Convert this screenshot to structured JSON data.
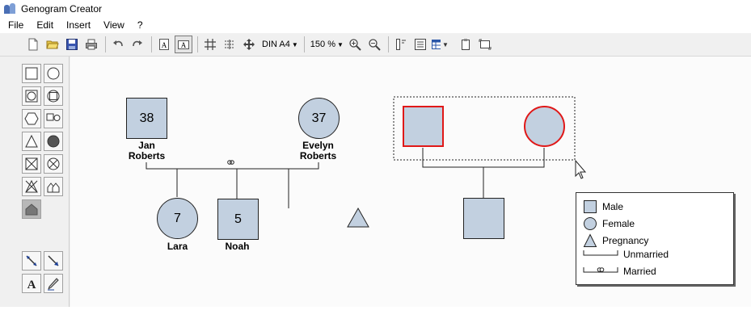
{
  "window": {
    "title": "Genogram Creator"
  },
  "menu": {
    "items": [
      "File",
      "Edit",
      "Insert",
      "View",
      "?"
    ]
  },
  "toolbar": {
    "page_size": "DIN A4",
    "zoom": "150 %"
  },
  "people": {
    "jan": {
      "age": "38",
      "first": "Jan",
      "last": "Roberts"
    },
    "evelyn": {
      "age": "37",
      "first": "Evelyn",
      "last": "Roberts"
    },
    "lara": {
      "age": "7",
      "name": "Lara"
    },
    "noah": {
      "age": "5",
      "name": "Noah"
    }
  },
  "legend": {
    "male": "Male",
    "female": "Female",
    "pregnancy": "Pregnancy",
    "unmarried": "Unmarried",
    "married": "Married"
  },
  "colors": {
    "shape_fill": "#c2d0e0",
    "selection": "#e01818",
    "line": "#222222"
  }
}
